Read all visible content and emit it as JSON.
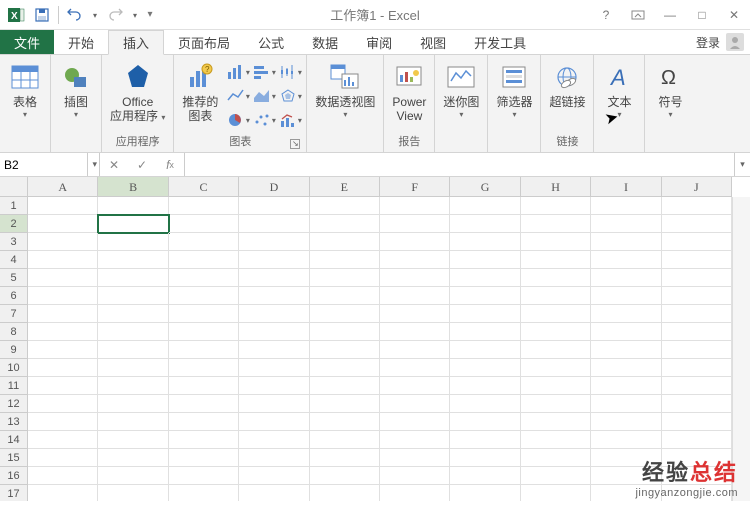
{
  "title": "工作簿1 - Excel",
  "qat": {
    "save": "保存",
    "undo": "撤销",
    "redo": "重做"
  },
  "win": {
    "help": "?",
    "ribbon_opts": "▭",
    "min": "—",
    "restore": "□",
    "close": "✕"
  },
  "tabs": {
    "file": "文件",
    "items": [
      "开始",
      "插入",
      "页面布局",
      "公式",
      "数据",
      "审阅",
      "视图",
      "开发工具"
    ],
    "active_index": 1,
    "login": "登录"
  },
  "ribbon": {
    "groups": {
      "tables": {
        "label": "表格",
        "btn": "表格"
      },
      "illustrations": {
        "label": "插图",
        "btn": "插图"
      },
      "apps": {
        "label": "应用程序",
        "btn_l1": "Office",
        "btn_l2": "应用程序"
      },
      "charts": {
        "label": "图表",
        "rec_l1": "推荐的",
        "rec_l2": "图表"
      },
      "pivot": {
        "label": "数据透视图",
        "btn": "数据透视图"
      },
      "report": {
        "label": "报告",
        "btn_l1": "Power",
        "btn_l2": "View"
      },
      "sparklines": {
        "label": "迷你图",
        "btn": "迷你图"
      },
      "filter": {
        "label": "筛选器",
        "btn": "筛选器"
      },
      "links": {
        "label": "链接",
        "btn": "超链接"
      },
      "text": {
        "label": "文本",
        "btn": "文本"
      },
      "symbols": {
        "label": "符号",
        "btn": "符号"
      }
    }
  },
  "namebox": {
    "value": "B2"
  },
  "formula": {
    "value": ""
  },
  "grid": {
    "columns": [
      "A",
      "B",
      "C",
      "D",
      "E",
      "F",
      "G",
      "H",
      "I",
      "J"
    ],
    "rows": [
      "1",
      "2",
      "3",
      "4",
      "5",
      "6",
      "7",
      "8",
      "9",
      "10",
      "11",
      "12",
      "13",
      "14",
      "15",
      "16",
      "17"
    ],
    "active_col": 1,
    "active_row": 1
  },
  "watermark": {
    "main_black": "经验",
    "main_red": "总结",
    "sub": "jingyanzongjie.com"
  }
}
